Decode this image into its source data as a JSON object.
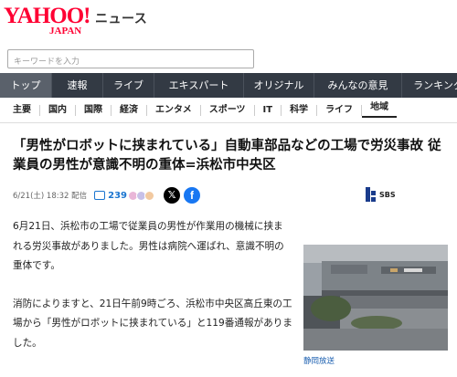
{
  "header": {
    "logo_main": "YAHOO!",
    "logo_sub": "JAPAN",
    "logo_news": "ニュース"
  },
  "search": {
    "placeholder": "キーワードを入力",
    "value": ""
  },
  "main_nav": {
    "items": [
      {
        "label": "トップ",
        "active": true
      },
      {
        "label": "速報"
      },
      {
        "label": "ライブ"
      },
      {
        "label": "エキスパート"
      },
      {
        "label": "オリジナル"
      },
      {
        "label": "みんなの意見"
      },
      {
        "label": "ランキング"
      }
    ]
  },
  "sub_nav": {
    "items": [
      {
        "label": "主要"
      },
      {
        "label": "国内"
      },
      {
        "label": "国際"
      },
      {
        "label": "経済"
      },
      {
        "label": "エンタメ"
      },
      {
        "label": "スポーツ"
      },
      {
        "label": "IT"
      },
      {
        "label": "科学"
      },
      {
        "label": "ライフ"
      },
      {
        "label": "地域",
        "active": true
      }
    ]
  },
  "article": {
    "headline": "「男性がロボットに挟まれている」自動車部品などの工場で労災事故 従業員の男性が意識不明の重体=浜松市中央区",
    "date": "6/21(土) 18:32 配信",
    "comment_count": "239",
    "source_logo": "SBS",
    "paragraphs": [
      "6月21日、浜松市の工場で従業員の男性が作業用の機械に挟まれる労災事故がありました。男性は病院へ運ばれ、意識不明の重体です。",
      "消防によりますと、21日午前9時ごろ、浜松市中央区高丘東の工場から「男性がロボットに挟まれている」と119番通報がありました。"
    ],
    "photo_caption": "静岡放送"
  },
  "colors": {
    "brand": "#ff0033",
    "nav_bg": "#333a44",
    "link": "#1b75d0",
    "facebook": "#1877f2"
  },
  "icons": [
    "comment-icon",
    "x-share-icon",
    "facebook-share-icon",
    "sbs-logo-icon"
  ]
}
